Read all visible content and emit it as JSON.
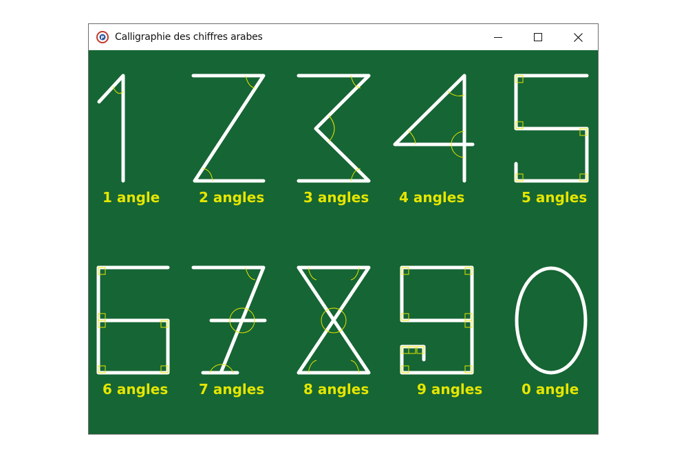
{
  "window": {
    "title": "Calligraphie des chiffres arabes",
    "controls": {
      "minimize": "minimize-icon",
      "maximize": "maximize-icon",
      "close": "close-icon"
    }
  },
  "colors": {
    "background": "#166534",
    "stroke": "#ffffff",
    "angle_marker": "#e6e600",
    "label": "#e6e600"
  },
  "digits": [
    {
      "digit": "1",
      "label": "1 angle"
    },
    {
      "digit": "2",
      "label": "2 angles"
    },
    {
      "digit": "3",
      "label": "3 angles"
    },
    {
      "digit": "4",
      "label": "4 angles"
    },
    {
      "digit": "5",
      "label": "5 angles"
    },
    {
      "digit": "6",
      "label": "6 angles"
    },
    {
      "digit": "7",
      "label": "7 angles"
    },
    {
      "digit": "8",
      "label": "8 angles"
    },
    {
      "digit": "9",
      "label": "9 angles"
    },
    {
      "digit": "0",
      "label": "0 angle"
    }
  ]
}
